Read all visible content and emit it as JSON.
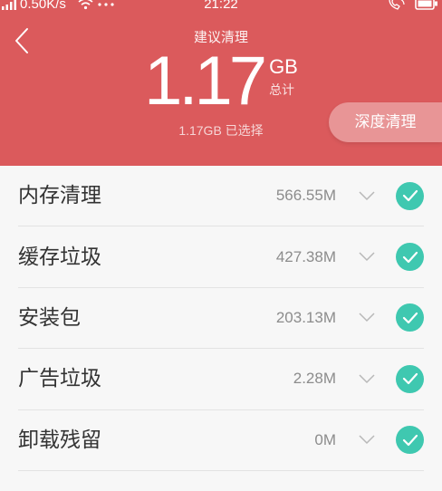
{
  "status_bar": {
    "network_speed": "0.50K/s",
    "time": "21:22",
    "icons": [
      "signal-icon",
      "wifi-icon",
      "more-dots-icon",
      "call-icon",
      "battery-icon"
    ]
  },
  "header": {
    "back_icon": "back-chevron-icon",
    "title": "建议清理",
    "total_value": "1.17",
    "total_unit": "GB",
    "total_caption": "总计",
    "selected_summary": "1.17GB 已选择",
    "deep_clean_button": "深度清理"
  },
  "items": [
    {
      "label": "内存清理",
      "size": "566.55M",
      "checked": true
    },
    {
      "label": "缓存垃圾",
      "size": "427.38M",
      "checked": true
    },
    {
      "label": "安装包",
      "size": "203.13M",
      "checked": true
    },
    {
      "label": "广告垃圾",
      "size": "2.28M",
      "checked": true
    },
    {
      "label": "卸载残留",
      "size": "0M",
      "checked": true
    }
  ],
  "colors": {
    "header_bg": "#db5a5c",
    "accent_check": "#3fc8b0",
    "list_bg": "#f7f7f7"
  }
}
